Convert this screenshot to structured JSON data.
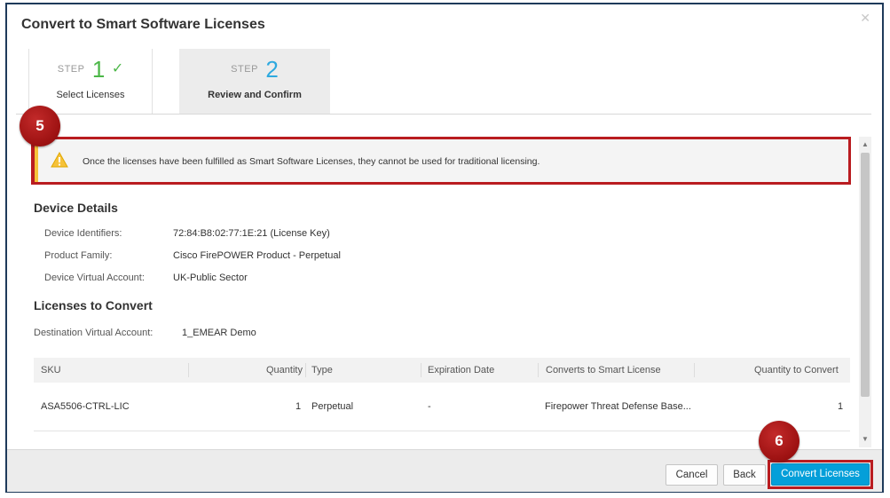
{
  "dialog": {
    "title": "Convert to Smart Software Licenses",
    "close_icon": "close-icon"
  },
  "wizard": {
    "steps": [
      {
        "word": "STEP",
        "number": "1",
        "label": "Select Licenses",
        "state": "complete"
      },
      {
        "word": "STEP",
        "number": "2",
        "label": "Review and Confirm",
        "state": "active"
      }
    ]
  },
  "callouts": {
    "a": "5",
    "b": "6"
  },
  "alert": {
    "icon": "warning-icon",
    "text": "Once the licenses have been fulfilled as Smart Software Licenses, they cannot be used for traditional licensing."
  },
  "device_details": {
    "title": "Device Details",
    "rows": [
      {
        "label": "Device Identifiers:",
        "value": "72:84:B8:02:77:1E:21 (License Key)"
      },
      {
        "label": "Product Family:",
        "value": "Cisco FirePOWER Product - Perpetual"
      },
      {
        "label": "Device Virtual Account:",
        "value": "UK-Public Sector"
      }
    ]
  },
  "licenses": {
    "title": "Licenses to Convert",
    "dest_label": "Destination Virtual Account:",
    "dest_value": "1_EMEAR Demo",
    "columns": [
      "SKU",
      "Quantity",
      "Type",
      "Expiration Date",
      "Converts to Smart License",
      "Quantity to Convert"
    ],
    "rows": [
      [
        "ASA5506-CTRL-LIC",
        "1",
        "Perpetual",
        "-",
        "Firepower Threat Defense Base...",
        "1"
      ]
    ]
  },
  "footer": {
    "cancel": "Cancel",
    "back": "Back",
    "convert": "Convert Licenses"
  },
  "colors": {
    "accent": "#049fd9",
    "callout_red": "#b91c20",
    "step_complete": "#4cb748",
    "step_active": "#2ea9df",
    "warning": "#f6c23a"
  }
}
